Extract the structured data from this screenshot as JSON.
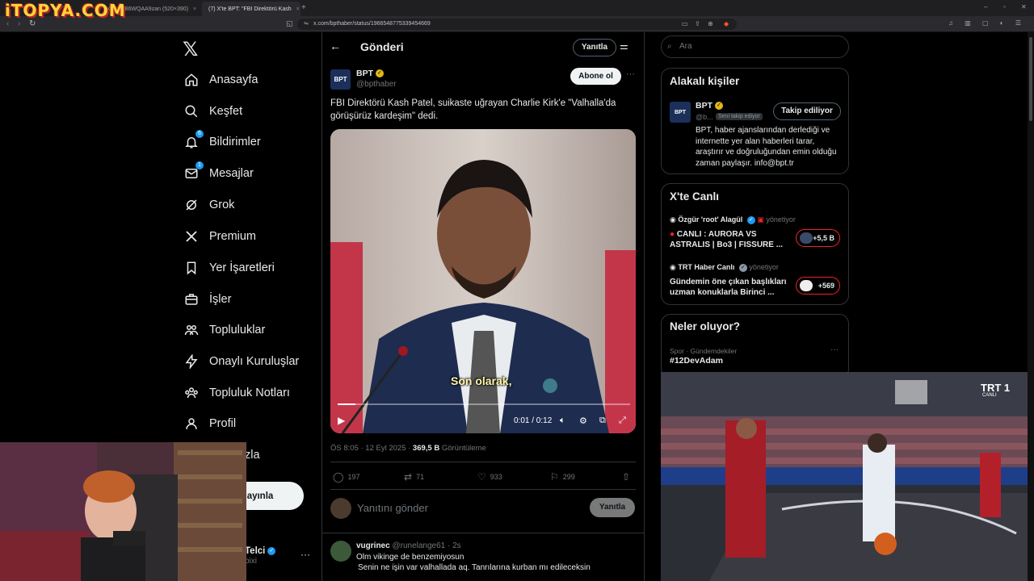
{
  "overlay_logo": "iTOPYA.COM",
  "browser": {
    "tabs": [
      {
        "label": "G0pc186WQAA9zan (520×390)",
        "active": false
      },
      {
        "label": "(7) X'te BPT: \"FBI Direktörü Kash",
        "active": true
      }
    ],
    "url": "x.com/bpthaber/status/1966548775339454669"
  },
  "nav": {
    "items": [
      {
        "label": "Anasayfa",
        "icon": "home-icon"
      },
      {
        "label": "Keşfet",
        "icon": "search-icon"
      },
      {
        "label": "Bildirimler",
        "icon": "bell-icon",
        "badge": "6"
      },
      {
        "label": "Mesajlar",
        "icon": "mail-icon",
        "badge": "1"
      },
      {
        "label": "Grok",
        "icon": "grok-icon"
      },
      {
        "label": "Premium",
        "icon": "x-premium-icon"
      },
      {
        "label": "Yer İşaretleri",
        "icon": "bookmark-icon"
      },
      {
        "label": "İşler",
        "icon": "briefcase-icon"
      },
      {
        "label": "Topluluklar",
        "icon": "communities-icon"
      },
      {
        "label": "Onaylı Kuruluşlar",
        "icon": "lightning-icon"
      },
      {
        "label": "Topluluk Notları",
        "icon": "community-notes-icon"
      },
      {
        "label": "Profil",
        "icon": "person-icon"
      }
    ],
    "more_partial": "zla",
    "post_partial": "ayınla",
    "user_name_partial": "Telci",
    "user_handle_partial": "bixi"
  },
  "main": {
    "header_title": "Gönderi",
    "reply_top": "Yanıtla",
    "author": {
      "name": "BPT",
      "handle": "@bpthaber",
      "follow": "Abone ol",
      "avatar_text": "BPT"
    },
    "text": "FBI Direktörü Kash Patel, suikaste uğrayan Charlie Kirk'e \"Valhalla'da görüşürüz kardeşim\" dedi.",
    "video": {
      "subtitle": "Son olarak,",
      "time": "0:01 / 0:12",
      "progress": 0.06
    },
    "meta": {
      "time": "ÖS 8:05 · 12 Eyl 2025 · ",
      "views": "369,5 B",
      "views_label": " Görüntüleme"
    },
    "actions": {
      "replies": "197",
      "reposts": "71",
      "likes": "933",
      "bookmarks": "299"
    },
    "reply_placeholder": "Yanıtını gönder",
    "reply_button": "Yanıtla",
    "comment": {
      "name": "vugrinec",
      "handle_time": "@runelange61 · 2s",
      "line1": "Olm vikinge de benzemiyosun",
      "line2": "Senin ne işin var valhallada aq. Tanrılarına kurban mı edileceksin"
    }
  },
  "right": {
    "search_placeholder": "Ara",
    "related": {
      "title": "Alakalı kişiler",
      "name": "BPT",
      "handle": "@b...",
      "tag": "Seni takip ediyor",
      "follow": "Takip ediliyor",
      "bio": "BPT, haber ajanslarından derlediği ve internette yer alan haberleri tarar, araştırır ve doğruluğundan emin olduğu zaman paylaşır. info@bpt.tr"
    },
    "live": {
      "title": "X'te Canlı",
      "items": [
        {
          "host": "Özgür 'root' Alagül",
          "role": "yönetiyor",
          "title": "CANLI : AURORA VS ASTRALIS | Bo3 | FISSURE ...",
          "count": "+5,5 B"
        },
        {
          "host": "TRT Haber Canlı",
          "role": "yönetiyor",
          "title": "Gündemin öne çıkan başlıkları uzman konuklarla Birinci ...",
          "count": "+569"
        }
      ]
    },
    "trends": {
      "title": "Neler oluyor?",
      "category": "Spor · Gündemdekiler",
      "tag": "#12DevAdam"
    }
  },
  "broadcast": {
    "channel": "TRT 1",
    "sub": "CANLI"
  },
  "colors": {
    "accent": "#1d9bf0",
    "gold_verified": "#e2b719",
    "live_red": "#f4212e"
  }
}
